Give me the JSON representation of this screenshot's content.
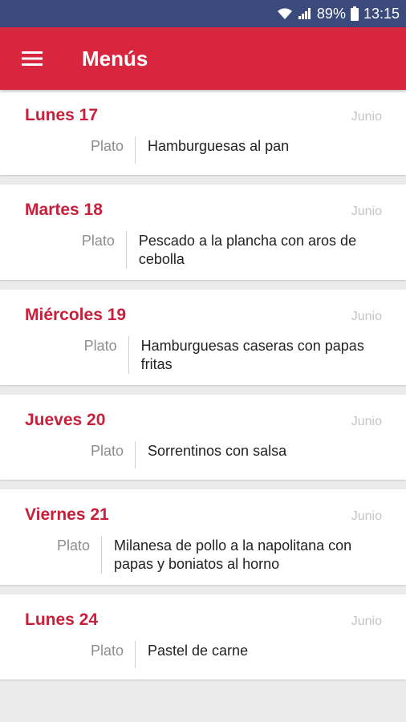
{
  "status_bar": {
    "battery": "89%",
    "time": "13:15",
    "icons": [
      "wifi-icon",
      "signal-icon",
      "battery-icon"
    ]
  },
  "app_bar": {
    "title": "Menús",
    "menu_icon": "hamburger-menu-icon",
    "color": "#d7263d"
  },
  "menus": [
    {
      "day": "Lunes 17",
      "month": "Junio",
      "label": "Plato",
      "dish": "Hamburguesas al pan"
    },
    {
      "day": "Martes 18",
      "month": "Junio",
      "label": "Plato",
      "dish": "Pescado a la plancha con aros de cebolla"
    },
    {
      "day": "Miércoles 19",
      "month": "Junio",
      "label": "Plato",
      "dish": "Hamburguesas caseras con papas fritas"
    },
    {
      "day": "Jueves 20",
      "month": "Junio",
      "label": "Plato",
      "dish": "Sorrentinos con salsa"
    },
    {
      "day": "Viernes 21",
      "month": "Junio",
      "label": "Plato",
      "dish": "Milanesa de pollo a la napolitana con papas y boniatos al horno"
    },
    {
      "day": "Lunes 24",
      "month": "Junio",
      "label": "Plato",
      "dish": "Pastel de carne"
    }
  ],
  "colors": {
    "status_bar": "#3a4a7a",
    "accent": "#d7263d",
    "day_text": "#c8203a"
  }
}
